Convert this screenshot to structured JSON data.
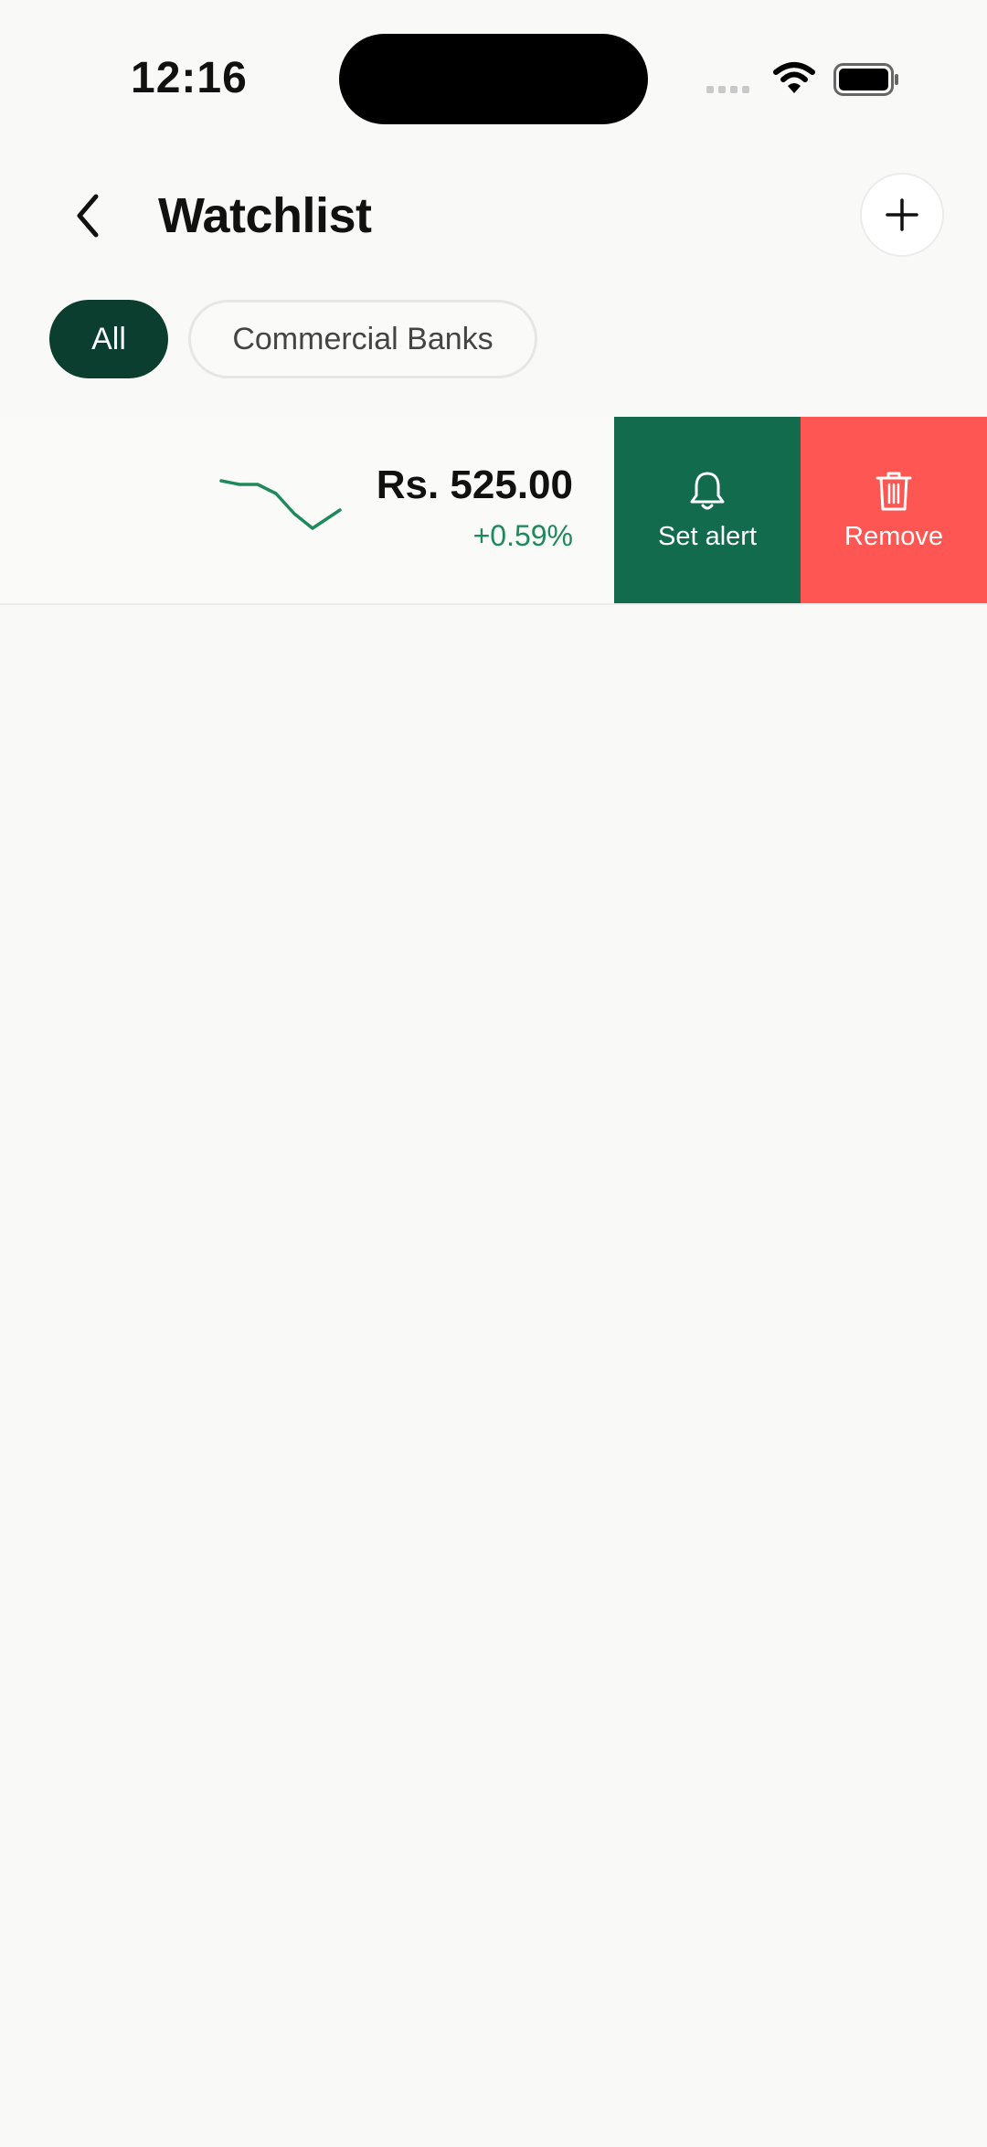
{
  "status_bar": {
    "time": "12:16"
  },
  "header": {
    "title": "Watchlist"
  },
  "filters": [
    {
      "label": "All",
      "active": true
    },
    {
      "label": "Commercial Banks",
      "active": false
    }
  ],
  "watchlist": [
    {
      "price": "Rs. 525.00",
      "change": "+0.59%",
      "actions": {
        "alert_label": "Set alert",
        "remove_label": "Remove"
      }
    }
  ],
  "colors": {
    "accent_dark": "#0b3e2e",
    "alert_bg": "#136b4e",
    "remove_bg": "#fe5652",
    "positive": "#1e8a5c"
  },
  "icons": [
    "back-arrow-icon",
    "plus-icon",
    "bell-icon",
    "trash-icon",
    "wifi-icon",
    "battery-icon",
    "cellular-icon"
  ]
}
